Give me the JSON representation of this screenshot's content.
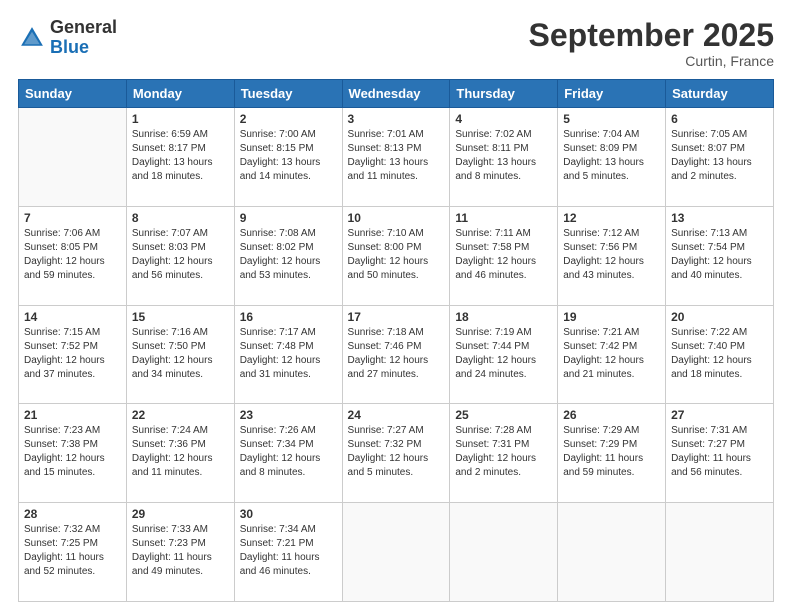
{
  "logo": {
    "line1": "General",
    "line2": "Blue"
  },
  "title": "September 2025",
  "subtitle": "Curtin, France",
  "days_header": [
    "Sunday",
    "Monday",
    "Tuesday",
    "Wednesday",
    "Thursday",
    "Friday",
    "Saturday"
  ],
  "weeks": [
    [
      {
        "num": "",
        "info": ""
      },
      {
        "num": "1",
        "info": "Sunrise: 6:59 AM\nSunset: 8:17 PM\nDaylight: 13 hours\nand 18 minutes."
      },
      {
        "num": "2",
        "info": "Sunrise: 7:00 AM\nSunset: 8:15 PM\nDaylight: 13 hours\nand 14 minutes."
      },
      {
        "num": "3",
        "info": "Sunrise: 7:01 AM\nSunset: 8:13 PM\nDaylight: 13 hours\nand 11 minutes."
      },
      {
        "num": "4",
        "info": "Sunrise: 7:02 AM\nSunset: 8:11 PM\nDaylight: 13 hours\nand 8 minutes."
      },
      {
        "num": "5",
        "info": "Sunrise: 7:04 AM\nSunset: 8:09 PM\nDaylight: 13 hours\nand 5 minutes."
      },
      {
        "num": "6",
        "info": "Sunrise: 7:05 AM\nSunset: 8:07 PM\nDaylight: 13 hours\nand 2 minutes."
      }
    ],
    [
      {
        "num": "7",
        "info": "Sunrise: 7:06 AM\nSunset: 8:05 PM\nDaylight: 12 hours\nand 59 minutes."
      },
      {
        "num": "8",
        "info": "Sunrise: 7:07 AM\nSunset: 8:03 PM\nDaylight: 12 hours\nand 56 minutes."
      },
      {
        "num": "9",
        "info": "Sunrise: 7:08 AM\nSunset: 8:02 PM\nDaylight: 12 hours\nand 53 minutes."
      },
      {
        "num": "10",
        "info": "Sunrise: 7:10 AM\nSunset: 8:00 PM\nDaylight: 12 hours\nand 50 minutes."
      },
      {
        "num": "11",
        "info": "Sunrise: 7:11 AM\nSunset: 7:58 PM\nDaylight: 12 hours\nand 46 minutes."
      },
      {
        "num": "12",
        "info": "Sunrise: 7:12 AM\nSunset: 7:56 PM\nDaylight: 12 hours\nand 43 minutes."
      },
      {
        "num": "13",
        "info": "Sunrise: 7:13 AM\nSunset: 7:54 PM\nDaylight: 12 hours\nand 40 minutes."
      }
    ],
    [
      {
        "num": "14",
        "info": "Sunrise: 7:15 AM\nSunset: 7:52 PM\nDaylight: 12 hours\nand 37 minutes."
      },
      {
        "num": "15",
        "info": "Sunrise: 7:16 AM\nSunset: 7:50 PM\nDaylight: 12 hours\nand 34 minutes."
      },
      {
        "num": "16",
        "info": "Sunrise: 7:17 AM\nSunset: 7:48 PM\nDaylight: 12 hours\nand 31 minutes."
      },
      {
        "num": "17",
        "info": "Sunrise: 7:18 AM\nSunset: 7:46 PM\nDaylight: 12 hours\nand 27 minutes."
      },
      {
        "num": "18",
        "info": "Sunrise: 7:19 AM\nSunset: 7:44 PM\nDaylight: 12 hours\nand 24 minutes."
      },
      {
        "num": "19",
        "info": "Sunrise: 7:21 AM\nSunset: 7:42 PM\nDaylight: 12 hours\nand 21 minutes."
      },
      {
        "num": "20",
        "info": "Sunrise: 7:22 AM\nSunset: 7:40 PM\nDaylight: 12 hours\nand 18 minutes."
      }
    ],
    [
      {
        "num": "21",
        "info": "Sunrise: 7:23 AM\nSunset: 7:38 PM\nDaylight: 12 hours\nand 15 minutes."
      },
      {
        "num": "22",
        "info": "Sunrise: 7:24 AM\nSunset: 7:36 PM\nDaylight: 12 hours\nand 11 minutes."
      },
      {
        "num": "23",
        "info": "Sunrise: 7:26 AM\nSunset: 7:34 PM\nDaylight: 12 hours\nand 8 minutes."
      },
      {
        "num": "24",
        "info": "Sunrise: 7:27 AM\nSunset: 7:32 PM\nDaylight: 12 hours\nand 5 minutes."
      },
      {
        "num": "25",
        "info": "Sunrise: 7:28 AM\nSunset: 7:31 PM\nDaylight: 12 hours\nand 2 minutes."
      },
      {
        "num": "26",
        "info": "Sunrise: 7:29 AM\nSunset: 7:29 PM\nDaylight: 11 hours\nand 59 minutes."
      },
      {
        "num": "27",
        "info": "Sunrise: 7:31 AM\nSunset: 7:27 PM\nDaylight: 11 hours\nand 56 minutes."
      }
    ],
    [
      {
        "num": "28",
        "info": "Sunrise: 7:32 AM\nSunset: 7:25 PM\nDaylight: 11 hours\nand 52 minutes."
      },
      {
        "num": "29",
        "info": "Sunrise: 7:33 AM\nSunset: 7:23 PM\nDaylight: 11 hours\nand 49 minutes."
      },
      {
        "num": "30",
        "info": "Sunrise: 7:34 AM\nSunset: 7:21 PM\nDaylight: 11 hours\nand 46 minutes."
      },
      {
        "num": "",
        "info": ""
      },
      {
        "num": "",
        "info": ""
      },
      {
        "num": "",
        "info": ""
      },
      {
        "num": "",
        "info": ""
      }
    ]
  ]
}
